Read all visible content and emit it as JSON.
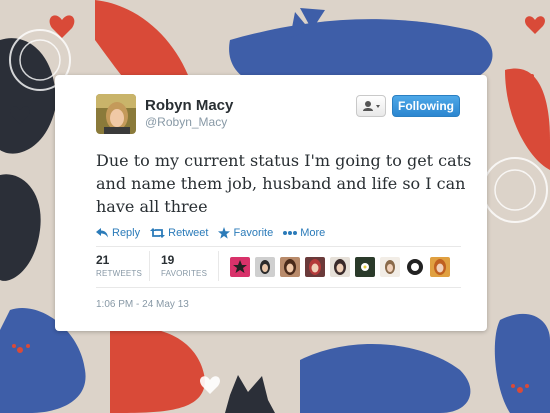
{
  "tweet": {
    "display_name": "Robyn Macy",
    "handle": "@Robyn_Macy",
    "text": "Due to my current status I'm going to get cats and name them job, husband and life so I can have all three",
    "timestamp": "1:06 PM - 24 May 13"
  },
  "buttons": {
    "user_actions_icon": "person-dropdown-icon",
    "follow_label": "Following"
  },
  "actions": [
    {
      "label": "Reply",
      "icon": "reply-icon"
    },
    {
      "label": "Retweet",
      "icon": "retweet-icon"
    },
    {
      "label": "Favorite",
      "icon": "star-icon"
    },
    {
      "label": "More",
      "icon": "more-dots-icon"
    }
  ],
  "stats": {
    "retweets": {
      "count": "21",
      "label": "RETWEETS"
    },
    "favorites": {
      "count": "19",
      "label": "FAVORITES"
    }
  },
  "favoriters": [
    "avatar-star-logo",
    "avatar-woman-1",
    "avatar-woman-2",
    "avatar-woman-3",
    "avatar-woman-4",
    "avatar-flower",
    "avatar-woman-5",
    "avatar-emblem",
    "avatar-woman-6"
  ],
  "colors": {
    "link_blue": "#2b7bb9",
    "follow_blue": "#3a9ae0",
    "text_dark": "#292f33",
    "text_gray": "#8899a6",
    "background": "#d9d0c6"
  }
}
